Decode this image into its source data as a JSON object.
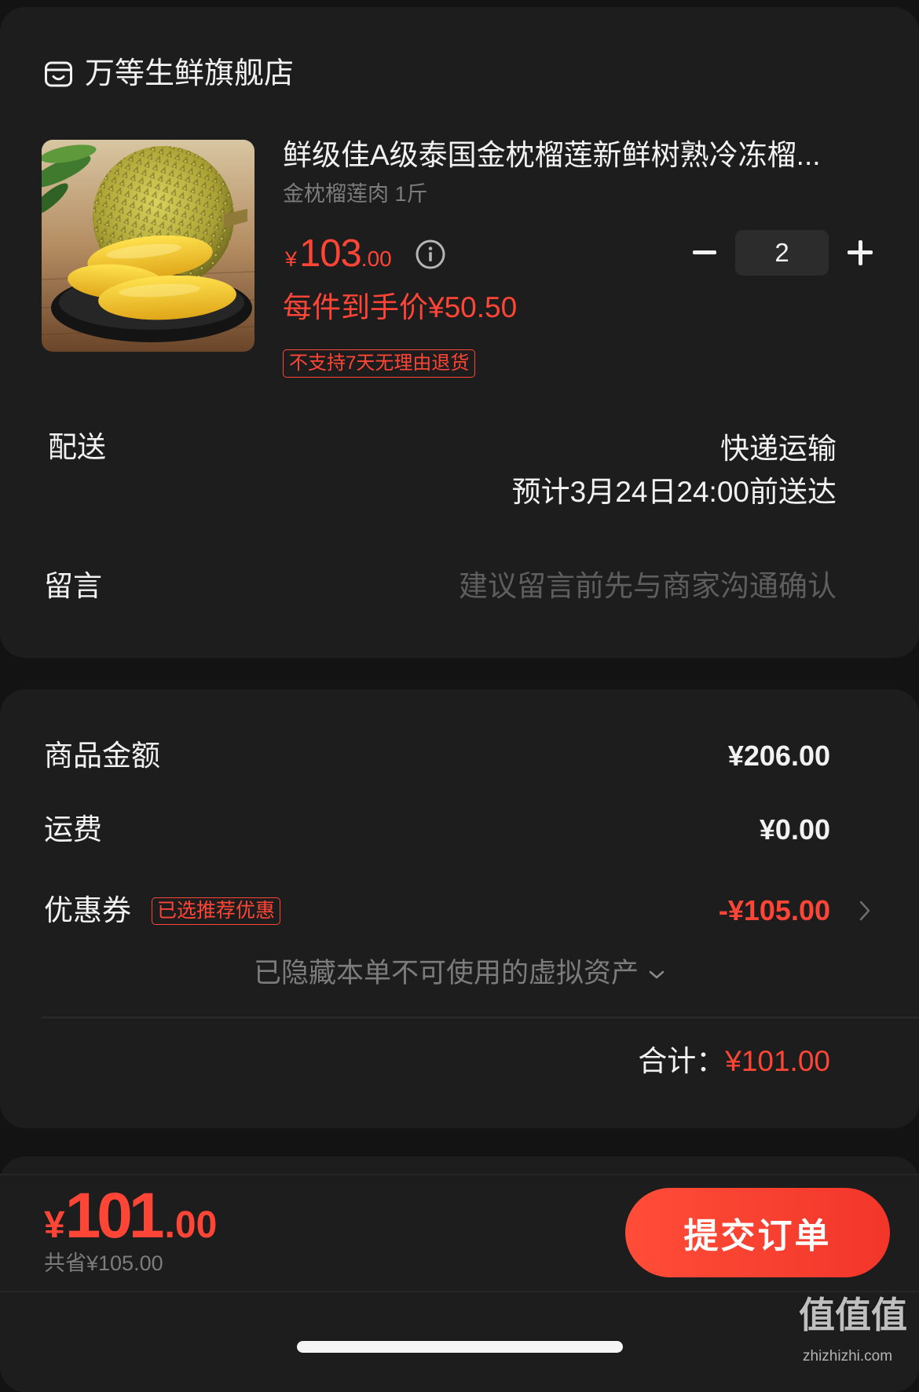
{
  "store": {
    "name": "万等生鲜旗舰店",
    "icon": "store-icon"
  },
  "product": {
    "title": "鲜级佳A级泰国金枕榴莲新鲜树熟冷冻榴...",
    "spec": "金枕榴莲肉 1斤",
    "price": {
      "currency": "¥",
      "integer": "103",
      "decimal": ".00"
    },
    "price_info_icon": "info-icon",
    "per_item_price": "每件到手价¥50.50",
    "return_policy_tag": "不支持7天无理由退货",
    "quantity": "2",
    "quantity_controls": {
      "decrease_icon": "minus-icon",
      "increase_icon": "plus-icon"
    }
  },
  "delivery": {
    "label": "配送",
    "method": "快递运输",
    "eta": "预计3月24日24:00前送达"
  },
  "message": {
    "label": "留言",
    "placeholder": "建议留言前先与商家沟通确认"
  },
  "summary": {
    "goods_amount": {
      "label": "商品金额",
      "value": "¥206.00"
    },
    "shipping_fee": {
      "label": "运费",
      "value": "¥0.00"
    },
    "coupon": {
      "label": "优惠券",
      "tag": "已选推荐优惠",
      "value": "-¥105.00",
      "icon": "chevron-right-icon"
    },
    "hidden_assets": {
      "text": "已隐藏本单不可使用的虚拟资产",
      "icon": "chevron-down-icon"
    },
    "total": {
      "label": "合计：",
      "value": "¥101.00"
    }
  },
  "footer": {
    "pay_amount": {
      "currency": "¥",
      "integer": "101",
      "decimal": ".00"
    },
    "saved": "共省¥105.00",
    "submit_label": "提交订单"
  },
  "watermark": {
    "logo": "值值值",
    "site": "zhizhizhi.com"
  },
  "colors": {
    "background": "#131313",
    "card": "#1d1d1d",
    "accent_red": "#ff4536",
    "text_primary": "#f2f2f2",
    "text_secondary": "#7c7c7c"
  }
}
